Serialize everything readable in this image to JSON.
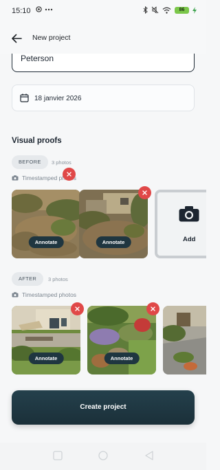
{
  "status_bar": {
    "time": "15:10",
    "battery": "86"
  },
  "header": {
    "title": "New project"
  },
  "form": {
    "name_value": "Peterson",
    "date_value": "18 janvier 2026"
  },
  "visual_proofs": {
    "title": "Visual proofs",
    "before": {
      "badge": "BEFORE",
      "count": "3 photos",
      "timestamp_label": "Timestamped photos",
      "annotate_label": "Annotate",
      "add_label": "Add"
    },
    "after": {
      "badge": "AFTER",
      "count": "3 photos",
      "timestamp_label": "Timestamped photos",
      "annotate_label": "Annotate"
    }
  },
  "actions": {
    "create_label": "Create project"
  },
  "colors": {
    "primary": "#1f3640",
    "remove": "#e04848",
    "badge_bg": "#e6e9ec"
  }
}
